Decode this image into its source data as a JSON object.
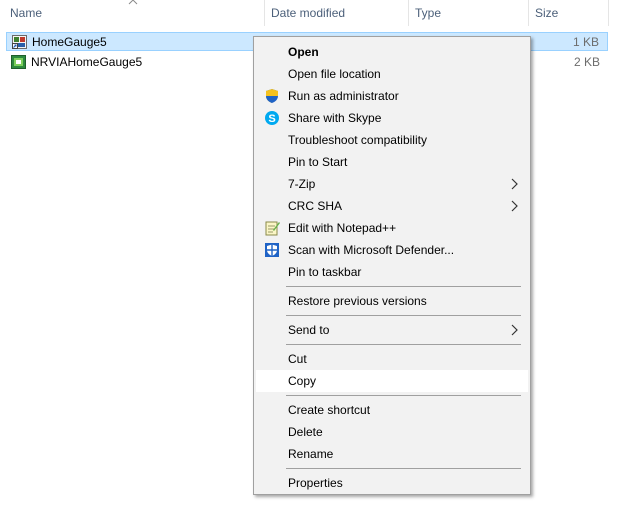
{
  "columns": {
    "name": "Name",
    "date_modified": "Date modified",
    "type": "Type",
    "size": "Size"
  },
  "files": [
    {
      "name": "HomeGauge5",
      "size": "1 KB",
      "icon": "shortcut-app-icon",
      "selected": true
    },
    {
      "name": "NRVIAHomeGauge5",
      "size": "2 KB",
      "icon": "green-app-icon",
      "selected": false
    }
  ],
  "menu": {
    "open": "Open",
    "open_file_location": "Open file location",
    "run_as_admin": "Run as administrator",
    "share_skype": "Share with Skype",
    "troubleshoot": "Troubleshoot compatibility",
    "pin_start": "Pin to Start",
    "seven_zip": "7-Zip",
    "crc_sha": "CRC SHA",
    "edit_notepad": "Edit with Notepad++",
    "scan_defender": "Scan with Microsoft Defender...",
    "pin_taskbar": "Pin to taskbar",
    "restore_versions": "Restore previous versions",
    "send_to": "Send to",
    "cut": "Cut",
    "copy": "Copy",
    "create_shortcut": "Create shortcut",
    "delete": "Delete",
    "rename": "Rename",
    "properties": "Properties"
  },
  "colors": {
    "selection_bg": "#cce8ff",
    "selection_border": "#99d1ff",
    "menu_bg": "#f2f2f2",
    "header_text": "#4c607a"
  }
}
